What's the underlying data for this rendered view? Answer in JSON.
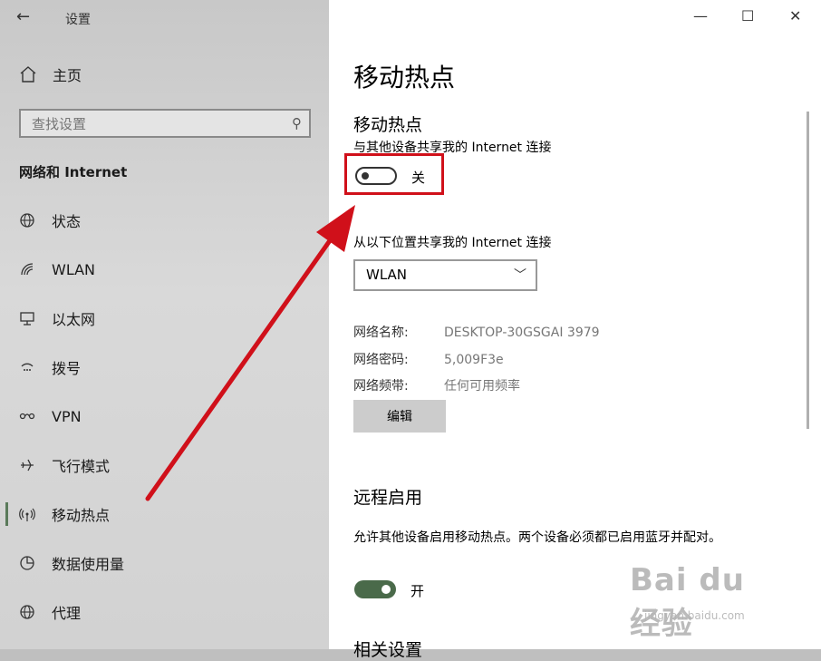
{
  "header": {
    "back_glyph": "←",
    "title": "设置"
  },
  "window_controls": {
    "minimize": "—",
    "maximize": "☐",
    "close": "✕"
  },
  "sidebar": {
    "home_label": "主页",
    "search_placeholder": "查找设置",
    "section_title": "网络和 Internet",
    "items": [
      {
        "label": "状态",
        "icon": "globe-icon"
      },
      {
        "label": "WLAN",
        "icon": "wifi-icon"
      },
      {
        "label": "以太网",
        "icon": "ethernet-icon"
      },
      {
        "label": "拨号",
        "icon": "dialup-icon"
      },
      {
        "label": "VPN",
        "icon": "vpn-icon"
      },
      {
        "label": "飞行模式",
        "icon": "airplane-icon"
      },
      {
        "label": "移动热点",
        "icon": "hotspot-icon",
        "active": true
      },
      {
        "label": "数据使用量",
        "icon": "data-usage-icon"
      },
      {
        "label": "代理",
        "icon": "proxy-icon"
      }
    ]
  },
  "main": {
    "page_title": "移动热点",
    "hotspot": {
      "subtitle": "移动热点",
      "share_desc": "与其他设备共享我的 Internet 连接",
      "toggle_state": "关",
      "share_from_desc": "从以下位置共享我的 Internet 连接",
      "connection_selected": "WLAN",
      "info": [
        {
          "key": "网络名称:",
          "value": "DESKTOP-30GSGAI 3979"
        },
        {
          "key": "网络密码:",
          "value": "5,009F3e"
        },
        {
          "key": "网络频带:",
          "value": "任何可用频率"
        }
      ],
      "edit_label": "编辑"
    },
    "remote": {
      "title": "远程启用",
      "desc": "允许其他设备启用移动热点。两个设备必须都已启用蓝牙并配对。",
      "toggle_state": "开"
    },
    "next_section_partial": "相关设置"
  },
  "watermark": {
    "brand": "Bai du 经验",
    "url": "jingyan.baidu.com"
  },
  "colors": {
    "annotation_red": "#d0101a",
    "toggle_on": "#4a6a4a"
  }
}
